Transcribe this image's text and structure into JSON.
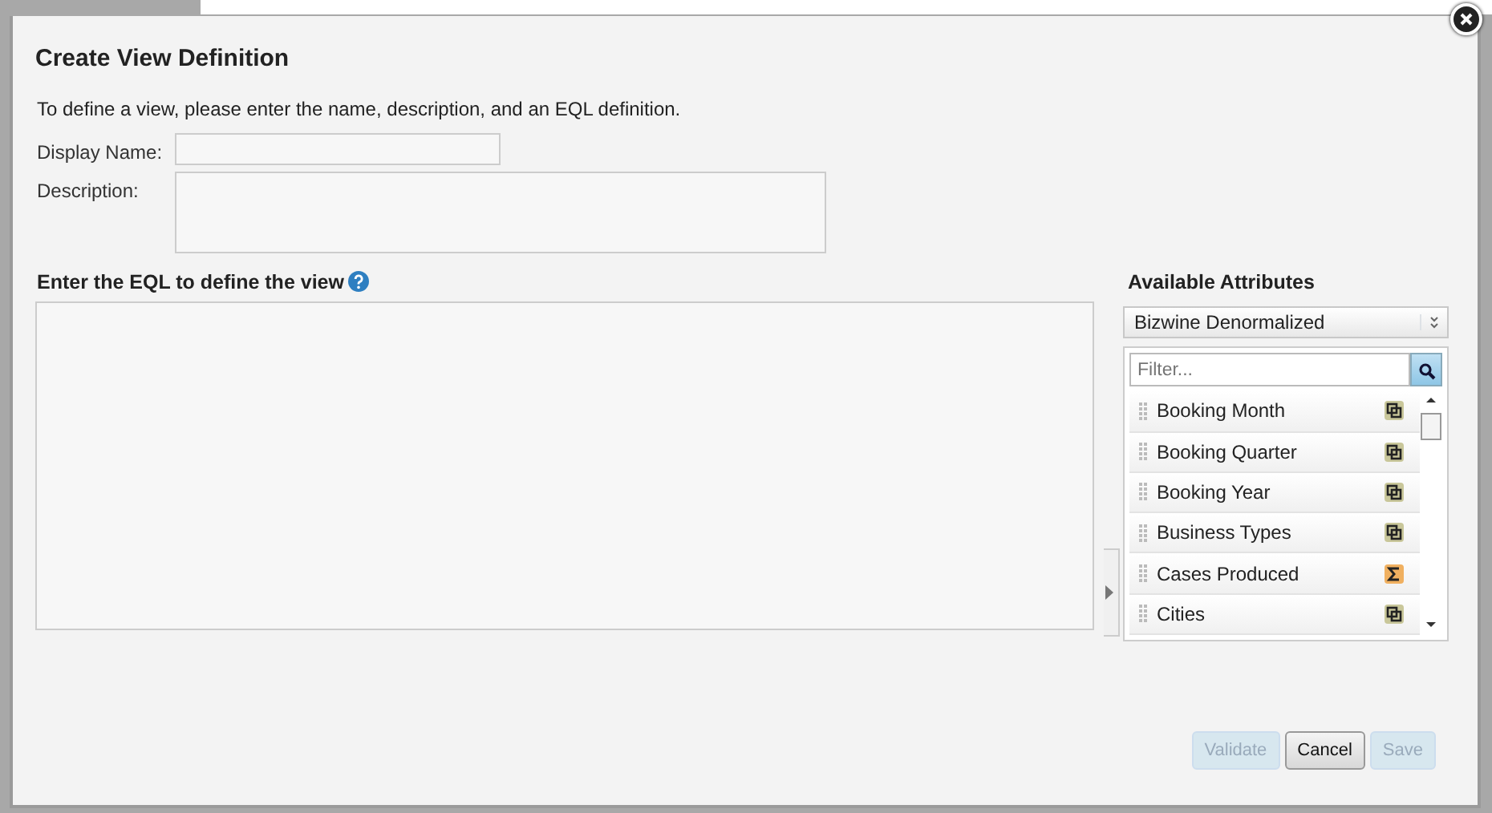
{
  "dialog": {
    "title": "Create View Definition",
    "intro": "To define a view, please enter the name, description, and an EQL definition.",
    "fields": [
      {
        "label": "Display Name:",
        "kind": "input"
      },
      {
        "label": "Description:",
        "kind": "textarea"
      }
    ],
    "eql": {
      "label": "Enter the EQL to define the view"
    },
    "attributes": {
      "title": "Available Attributes",
      "source": "Bizwine Denormalized",
      "filter": {
        "placeholder": "Filter..."
      },
      "items": [
        {
          "name": "Booking Month",
          "kind": "dimension"
        },
        {
          "name": "Booking Quarter",
          "kind": "dimension"
        },
        {
          "name": "Booking Year",
          "kind": "dimension"
        },
        {
          "name": "Business Types",
          "kind": "dimension"
        },
        {
          "name": "Cases Produced",
          "kind": "metric"
        },
        {
          "name": "Cities",
          "kind": "dimension"
        }
      ]
    },
    "buttons": [
      {
        "label": "Validate",
        "disabled": true
      },
      {
        "label": "Cancel",
        "disabled": false
      },
      {
        "label": "Save",
        "disabled": true
      }
    ]
  }
}
